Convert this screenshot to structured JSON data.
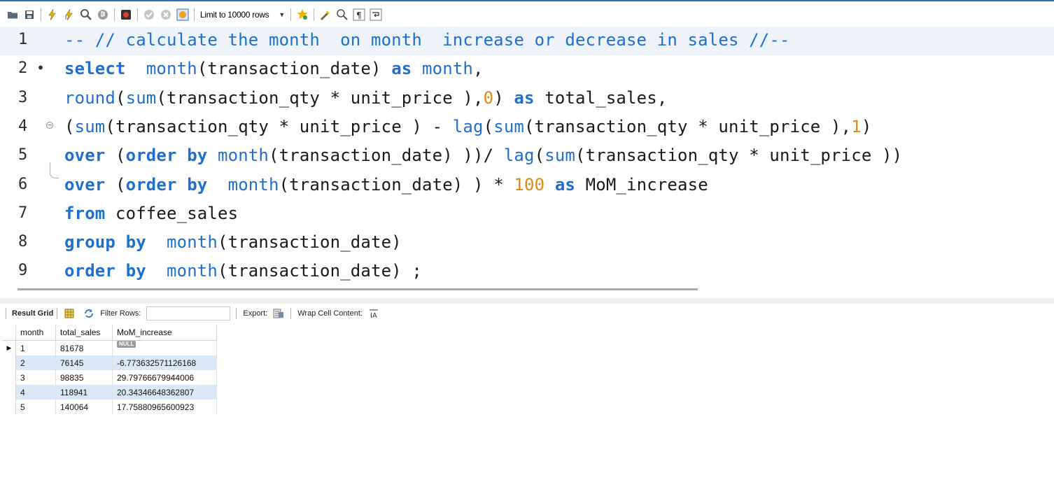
{
  "toolbar": {
    "limit_select": "Limit to 10000 rows",
    "icons": [
      "folder-icon",
      "save-icon",
      "execute-icon",
      "execute-current-icon",
      "explain-icon",
      "stop-icon",
      "toggle-errors-icon",
      "commit-icon",
      "rollback-icon",
      "autocommit-icon",
      "limit-select",
      "bookmark-icon",
      "beautify-icon",
      "find-icon",
      "invisible-chars-icon",
      "wrap-icon"
    ]
  },
  "editor": {
    "lines": [
      {
        "n": "1",
        "tokens": [
          {
            "t": "-- // calculate the month  on month  increase or decrease in sales //--",
            "c": "cmt"
          }
        ]
      },
      {
        "n": "2",
        "marker": "•",
        "tokens": [
          {
            "t": "select",
            "c": "kw"
          },
          {
            "t": "  ",
            "c": "plain"
          },
          {
            "t": "month",
            "c": "fn"
          },
          {
            "t": "(transaction_date) ",
            "c": "plain"
          },
          {
            "t": "as",
            "c": "kw"
          },
          {
            "t": " ",
            "c": "plain"
          },
          {
            "t": "month",
            "c": "fn"
          },
          {
            "t": ",",
            "c": "plain"
          }
        ]
      },
      {
        "n": "3",
        "tokens": [
          {
            "t": "round",
            "c": "fn"
          },
          {
            "t": "(",
            "c": "plain"
          },
          {
            "t": "sum",
            "c": "fn"
          },
          {
            "t": "(transaction_qty * unit_price ),",
            "c": "plain"
          },
          {
            "t": "0",
            "c": "num"
          },
          {
            "t": ") ",
            "c": "plain"
          },
          {
            "t": "as",
            "c": "kw"
          },
          {
            "t": " total_sales,",
            "c": "plain"
          }
        ]
      },
      {
        "n": "4",
        "fold": true,
        "tokens": [
          {
            "t": "(",
            "c": "plain"
          },
          {
            "t": "sum",
            "c": "fn"
          },
          {
            "t": "(transaction_qty * unit_price ) - ",
            "c": "plain"
          },
          {
            "t": "lag",
            "c": "fn"
          },
          {
            "t": "(",
            "c": "plain"
          },
          {
            "t": "sum",
            "c": "fn"
          },
          {
            "t": "(transaction_qty * unit_price ),",
            "c": "plain"
          },
          {
            "t": "1",
            "c": "num"
          },
          {
            "t": ")",
            "c": "plain"
          }
        ]
      },
      {
        "n": "5",
        "tokens": [
          {
            "t": "over",
            "c": "kw"
          },
          {
            "t": " (",
            "c": "plain"
          },
          {
            "t": "order by",
            "c": "kw"
          },
          {
            "t": " ",
            "c": "plain"
          },
          {
            "t": "month",
            "c": "fn"
          },
          {
            "t": "(transaction_date) ))/ ",
            "c": "plain"
          },
          {
            "t": "lag",
            "c": "fn"
          },
          {
            "t": "(",
            "c": "plain"
          },
          {
            "t": "sum",
            "c": "fn"
          },
          {
            "t": "(transaction_qty * unit_price ))",
            "c": "plain"
          }
        ]
      },
      {
        "n": "6",
        "tokens": [
          {
            "t": "over",
            "c": "kw"
          },
          {
            "t": " (",
            "c": "plain"
          },
          {
            "t": "order by",
            "c": "kw"
          },
          {
            "t": "  ",
            "c": "plain"
          },
          {
            "t": "month",
            "c": "fn"
          },
          {
            "t": "(transaction_date) ) * ",
            "c": "plain"
          },
          {
            "t": "100",
            "c": "num"
          },
          {
            "t": " ",
            "c": "plain"
          },
          {
            "t": "as",
            "c": "kw"
          },
          {
            "t": " MoM_increase",
            "c": "plain"
          }
        ]
      },
      {
        "n": "7",
        "tokens": [
          {
            "t": "from",
            "c": "kw"
          },
          {
            "t": " coffee_sales",
            "c": "plain"
          }
        ]
      },
      {
        "n": "8",
        "tokens": [
          {
            "t": "group by",
            "c": "kw"
          },
          {
            "t": "  ",
            "c": "plain"
          },
          {
            "t": "month",
            "c": "fn"
          },
          {
            "t": "(transaction_date)",
            "c": "plain"
          }
        ]
      },
      {
        "n": "9",
        "tokens": [
          {
            "t": "order by",
            "c": "kw"
          },
          {
            "t": "  ",
            "c": "plain"
          },
          {
            "t": "month",
            "c": "fn"
          },
          {
            "t": "(transaction_date) ;",
            "c": "plain"
          }
        ]
      }
    ]
  },
  "result_bar": {
    "result_grid": "Result Grid",
    "filter_rows": "Filter Rows:",
    "export": "Export:",
    "wrap": "Wrap Cell Content:"
  },
  "grid": {
    "columns": [
      "month",
      "total_sales",
      "MoM_increase"
    ],
    "rows": [
      {
        "month": "1",
        "total_sales": "81678",
        "mom": "NULL",
        "is_null": true
      },
      {
        "month": "2",
        "total_sales": "76145",
        "mom": "-6.773632571126168"
      },
      {
        "month": "3",
        "total_sales": "98835",
        "mom": "29.79766679944006"
      },
      {
        "month": "4",
        "total_sales": "118941",
        "mom": "20.34346648362807"
      },
      {
        "month": "5",
        "total_sales": "140064",
        "mom": "17.75880965600923"
      }
    ]
  },
  "colors": {
    "keyword": "#1f6fcf",
    "number": "#e08a12",
    "accent": "#2e6fbf",
    "row_alt": "#dbe8f7"
  }
}
